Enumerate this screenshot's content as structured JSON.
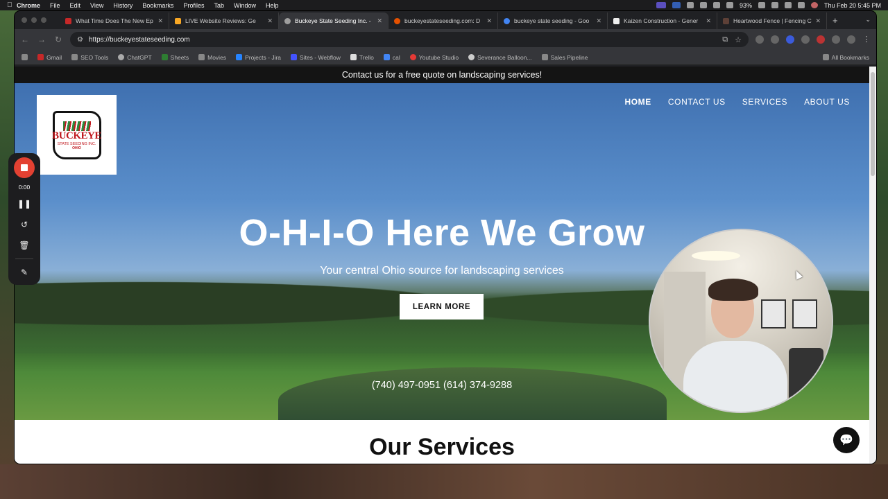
{
  "menubar": {
    "app": "Chrome",
    "items": [
      "File",
      "Edit",
      "View",
      "History",
      "Bookmarks",
      "Profiles",
      "Tab",
      "Window",
      "Help"
    ],
    "battery": "93%",
    "datetime": "Thu Feb 20  5:45 PM"
  },
  "tabs": [
    {
      "label": "What Time Does The New Ep",
      "color": "#c62828"
    },
    {
      "label": "LIVE Website Reviews: Ge",
      "color": "#f9a825"
    },
    {
      "label": "Buckeye State Seeding Inc. -",
      "color": "#9e9e9e"
    },
    {
      "label": "buckeyestateseeding.com: D",
      "color": "#e65100"
    },
    {
      "label": "buckeye state seeding - Goo",
      "color": "#4285f4"
    },
    {
      "label": "Kaizen Construction - Gener",
      "color": "#eeeeee"
    },
    {
      "label": "Heartwood Fence | Fencing C",
      "color": "#5d4037"
    }
  ],
  "url": "https://buckeyestateseeding.com",
  "bookmarks": [
    {
      "label": "Gmail"
    },
    {
      "label": "SEO Tools"
    },
    {
      "label": "ChatGPT"
    },
    {
      "label": "Sheets"
    },
    {
      "label": "Movies"
    },
    {
      "label": "Projects - Jira"
    },
    {
      "label": "Sites - Webflow"
    },
    {
      "label": "Trello"
    },
    {
      "label": "cal"
    },
    {
      "label": "Youtube Studio"
    },
    {
      "label": "Severance Balloon..."
    },
    {
      "label": "Sales Pipeline"
    }
  ],
  "all_bookmarks": "All Bookmarks",
  "site": {
    "announcement": "Contact us for a free quote on landscaping services!",
    "logo": {
      "brand": "BUCKEYE",
      "sub": "STATE SEEDING INC.",
      "sub2": "OHIO"
    },
    "nav": [
      "HOME",
      "CONTACT US",
      "SERVICES",
      "ABOUT US"
    ],
    "hero_title": "O-H-I-O Here We Grow",
    "hero_subtitle": "Your central Ohio source for landscaping services",
    "cta": "LEARN MORE",
    "phones": "(740) 497-0951 (614) 374-9288",
    "services_title": "Our Services"
  },
  "recorder": {
    "time": "0:00"
  }
}
